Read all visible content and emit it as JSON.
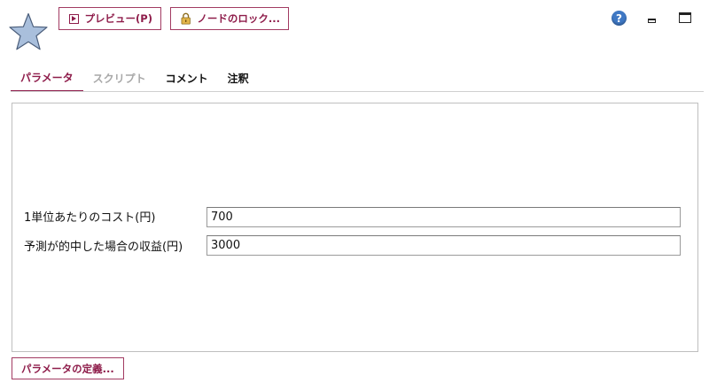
{
  "toolbar": {
    "preview_label": "プレビュー(P)",
    "lock_label": "ノードのロック..."
  },
  "window_controls": {
    "help_glyph": "?",
    "icons": [
      "help-icon",
      "minimize-icon",
      "maximize-icon"
    ]
  },
  "node_icon": "star-icon",
  "tabs": [
    {
      "label": "パラメータ",
      "state": "active"
    },
    {
      "label": "スクリプト",
      "state": "disabled"
    },
    {
      "label": "コメント",
      "state": "normal"
    },
    {
      "label": "注釈",
      "state": "normal"
    }
  ],
  "parameters": [
    {
      "label": "1単位あたりのコスト(円)",
      "value": "700"
    },
    {
      "label": "予測が的中した場合の収益(円)",
      "value": "3000"
    }
  ],
  "footer": {
    "define_label": "パラメータの定義..."
  },
  "colors": {
    "accent": "#8e1c4a",
    "star_fill": "#a9bfdc",
    "help_blue": "#3f78c4"
  }
}
